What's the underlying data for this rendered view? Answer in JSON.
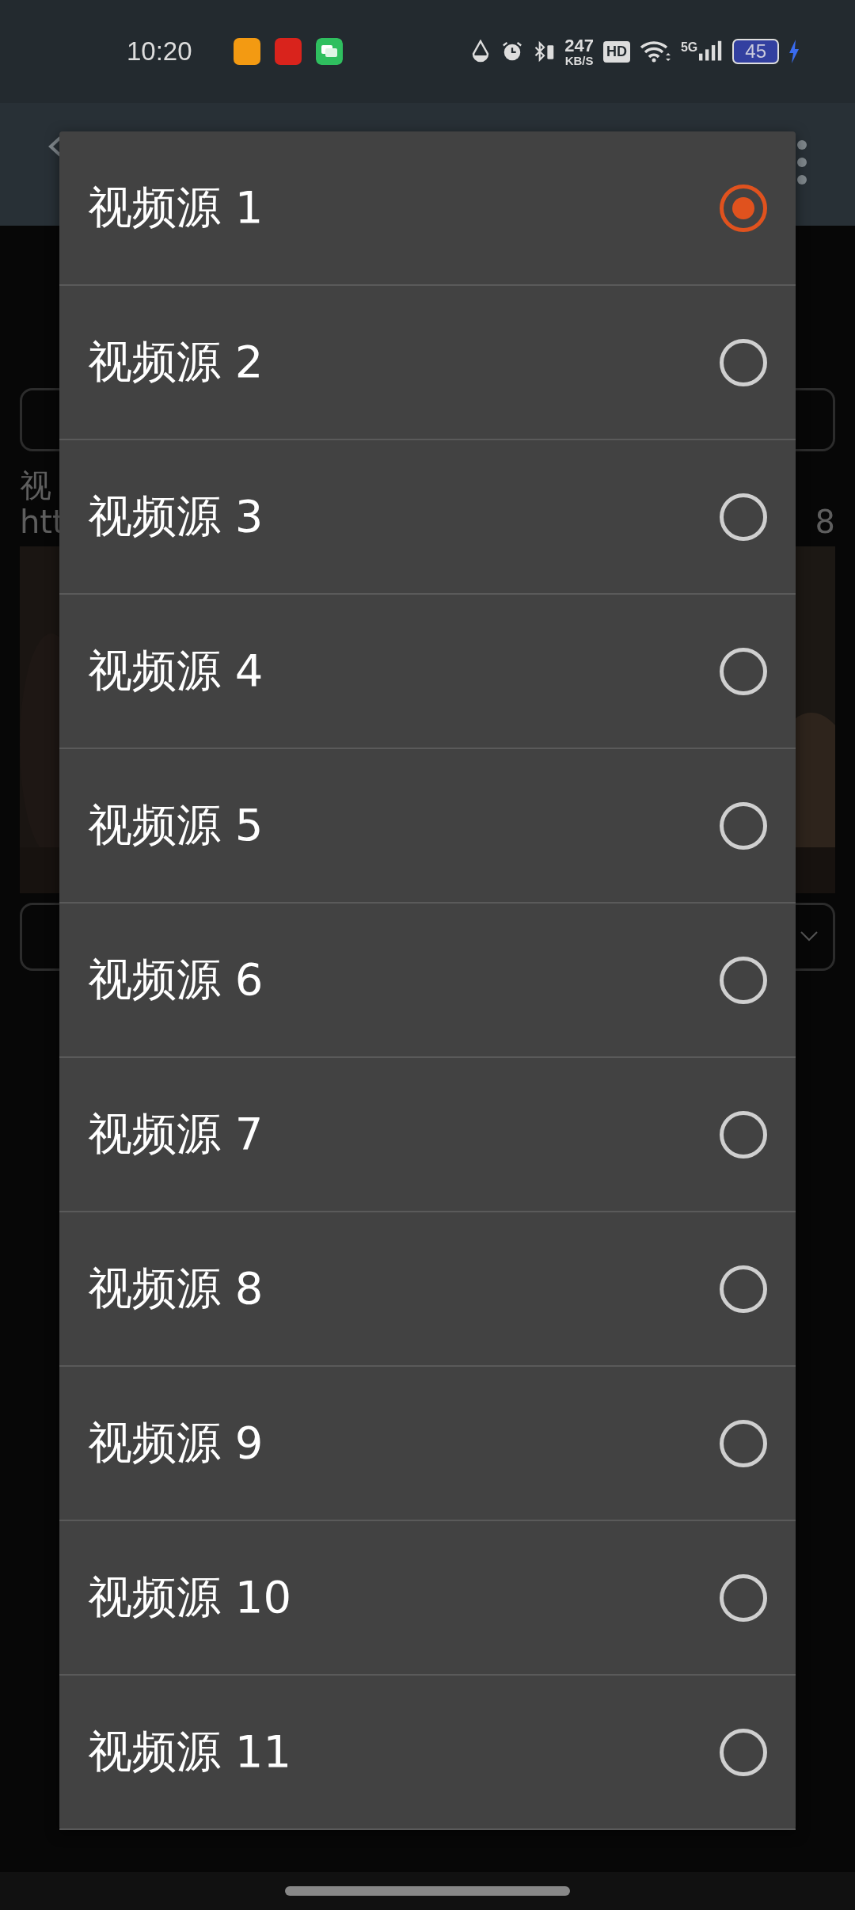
{
  "status_bar": {
    "time": "10:20",
    "speed_value": "247",
    "speed_unit": "KB/S",
    "hd": "HD",
    "network": "5G",
    "battery": "45"
  },
  "background": {
    "label": "视",
    "url_start": "htt",
    "url_end": "8"
  },
  "options": [
    {
      "label": "视频源 1",
      "selected": true
    },
    {
      "label": "视频源 2",
      "selected": false
    },
    {
      "label": "视频源 3",
      "selected": false
    },
    {
      "label": "视频源 4",
      "selected": false
    },
    {
      "label": "视频源 5",
      "selected": false
    },
    {
      "label": "视频源 6",
      "selected": false
    },
    {
      "label": "视频源 7",
      "selected": false
    },
    {
      "label": "视频源 8",
      "selected": false
    },
    {
      "label": "视频源 9",
      "selected": false
    },
    {
      "label": "视频源 10",
      "selected": false
    },
    {
      "label": "视频源 11",
      "selected": false
    }
  ]
}
